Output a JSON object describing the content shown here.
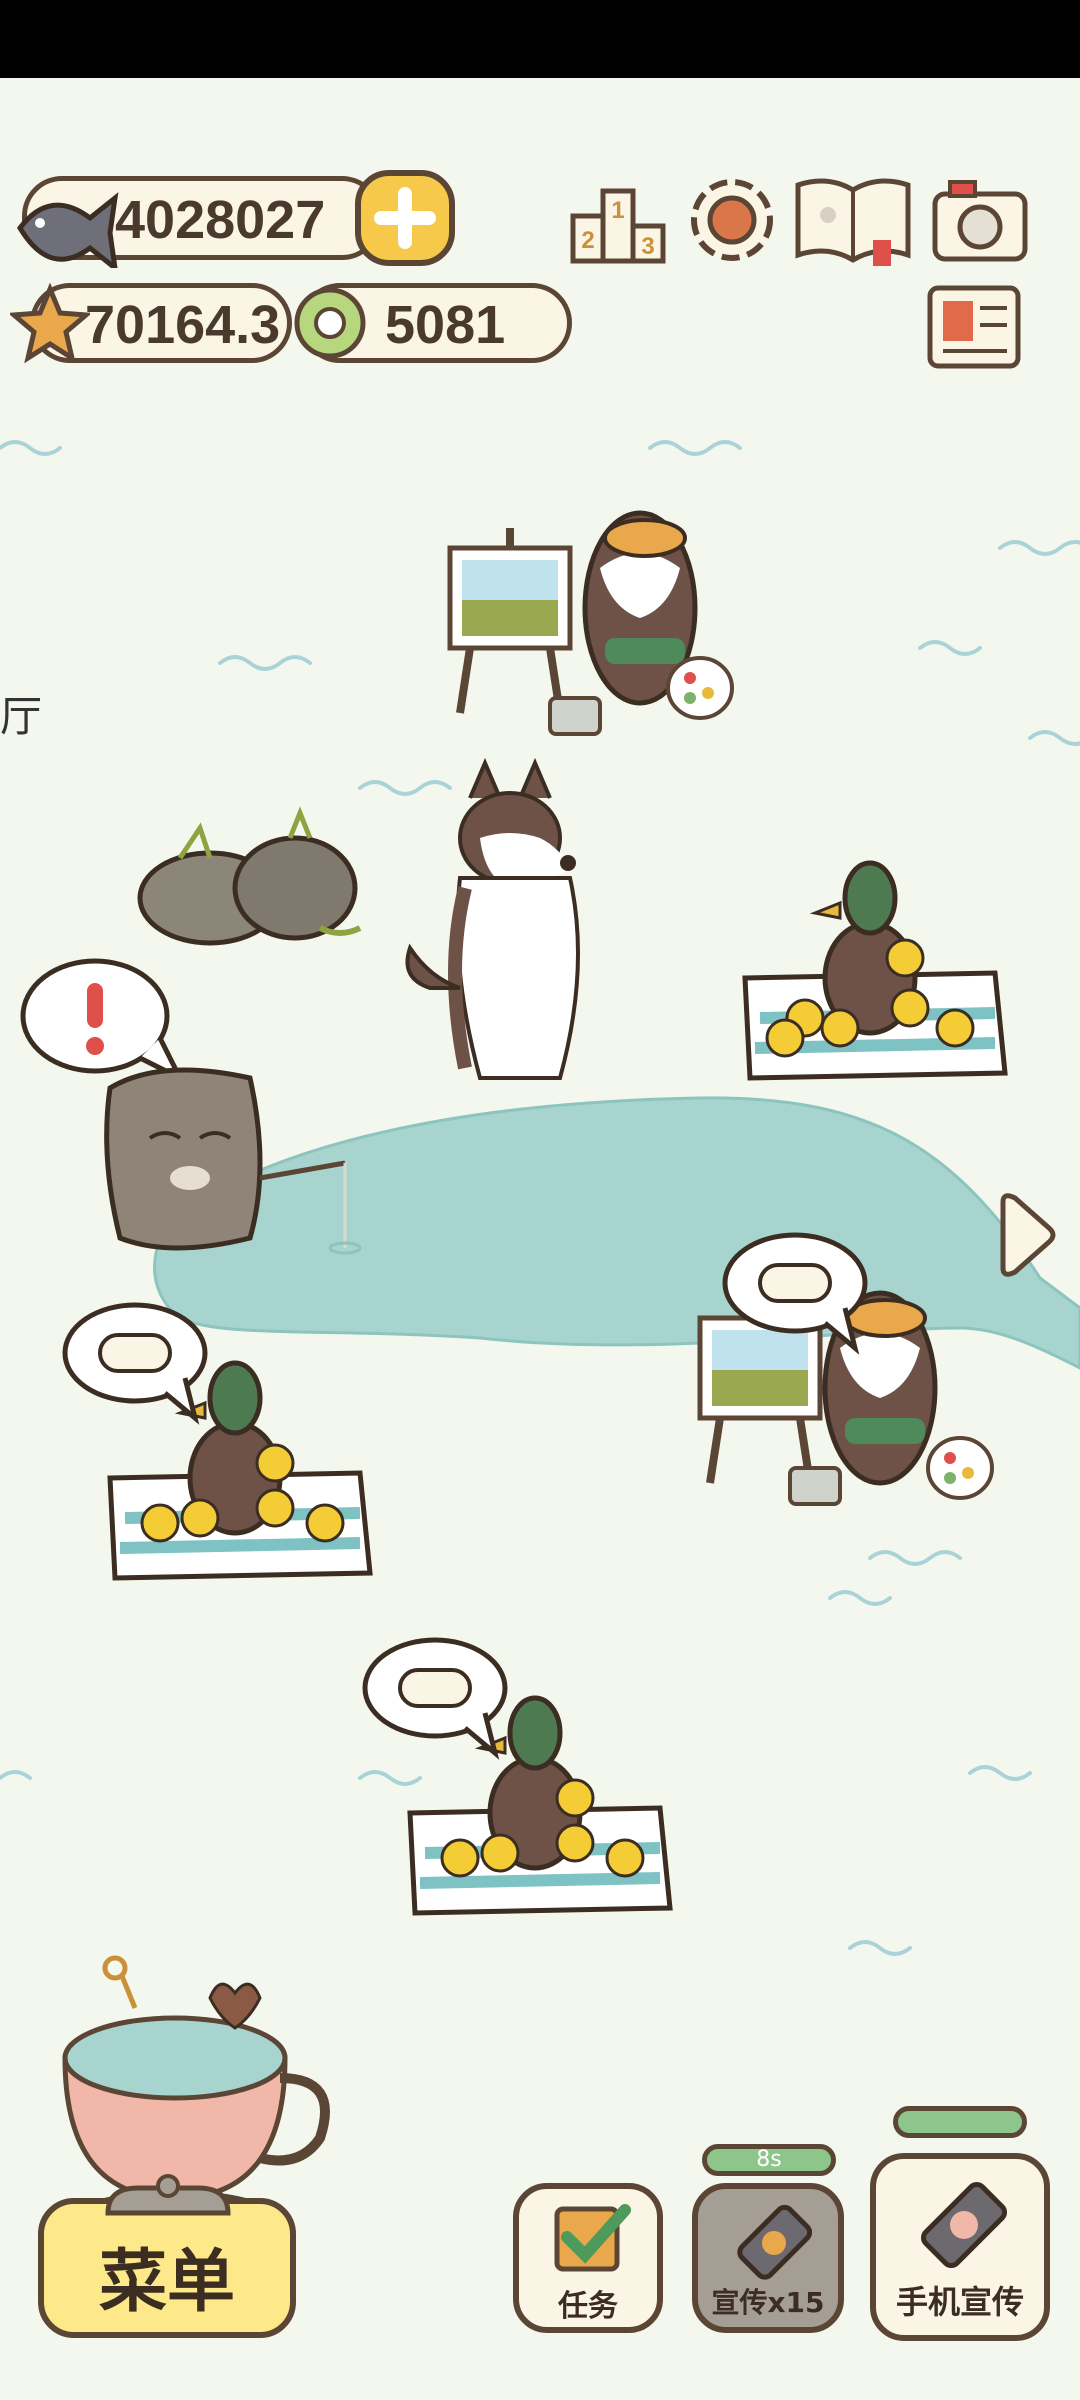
{
  "currency": {
    "fish_count": "4028027",
    "star_count": "70164.3",
    "token_count": "5081"
  },
  "left_edge_text": "厅",
  "buttons": {
    "menu_label": "菜单",
    "task_label": "任务",
    "promote_label": "宣传x15",
    "promote_timer": "8s",
    "phone_promote_label": "手机宣传"
  },
  "icons": {
    "ranking": "ranking-podium-icon",
    "settings": "gear-icon",
    "album": "book-icon",
    "camera": "camera-icon",
    "news": "newspaper-icon"
  },
  "colors": {
    "background": "#f4f7ee",
    "pond": "#a7d4cf",
    "outline": "#5b4636",
    "button_yellow": "#fde98a",
    "panel_cream": "#fbf5e6"
  }
}
